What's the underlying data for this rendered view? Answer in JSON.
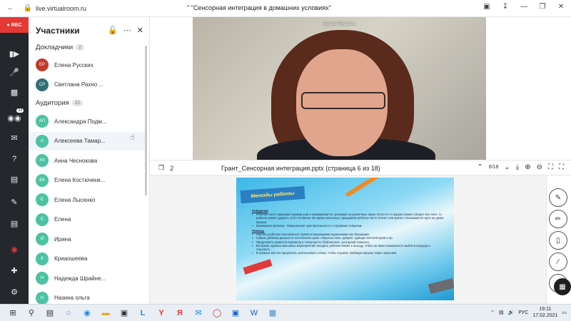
{
  "browser": {
    "url": "live.virtualroom.ru",
    "tab_title": "\" \"Сенсорная интеграция в домашних условиях\""
  },
  "rail": {
    "rec_label": "REC",
    "chat_badge": "24"
  },
  "panel": {
    "title": "Участники",
    "speakers_label": "Докладчики",
    "speakers_count": "2",
    "audience_label": "Аудитория",
    "audience_count": "22",
    "speakers": [
      {
        "initials": "ЕР",
        "name": "Елена Русских",
        "color": "#c0392b"
      },
      {
        "initials": "СР",
        "name": "Светлана Рахно ...",
        "color": "#2f6f73"
      }
    ],
    "audience": [
      {
        "initials": "АП",
        "name": "Александра Подм...",
        "color": "#4cc3a2"
      },
      {
        "initials": "А",
        "name": "Алексеева Тамар...",
        "color": "#4cc3a2"
      },
      {
        "initials": "АЧ",
        "name": "Анна Чеснокова",
        "color": "#4cc3a2"
      },
      {
        "initials": "ЕК",
        "name": "Елена Костюченк...",
        "color": "#4cc3a2"
      },
      {
        "initials": "Е",
        "name": "Елена Лысенко",
        "color": "#4cc3a2"
      },
      {
        "initials": "Е",
        "name": "Елена",
        "color": "#4cc3a2"
      },
      {
        "initials": "И",
        "name": "Ирина",
        "color": "#4cc3a2"
      },
      {
        "initials": "К",
        "name": "Криаошеева",
        "color": "#4cc3a2"
      },
      {
        "initials": "Н",
        "name": "Надежда Шрайне...",
        "color": "#4cc3a2"
      },
      {
        "initials": "Н",
        "name": "Назина ольга",
        "color": "#4cc3a2"
      }
    ]
  },
  "video": {
    "speaker_name": "Елена Русских"
  },
  "presentation": {
    "layout_count": "2",
    "file_title": "Грант_Сенсорная интеграция.pptx (страница 6 из 18)",
    "pager": "6/18"
  },
  "slide": {
    "title": "Методы работы",
    "sections": [
      {
        "heading": "Поведение",
        "items": [
          "Ребенок часто закрывает руками уши и зажмуривается, реагируя на различные звуки. Если кто-то рядом громко говорит или поет, то ребенок может ударить этого человека. Во время школьных праздников ребенок часто плачет или кричит, отказывается идти на уроки музыки.",
          "Возможная причина - Повышенная чувствительность к слуховым стимулам."
        ]
      },
      {
        "heading": "Помощь",
        "items": [
          "Научить ребенка пользоваться шумопоглощающими наушниками или берушами.",
          "Сажать ребенка дальше от источников шума: открытых окон, дверей, гудящих вентиляторов и пр.",
          "Предложить провести перемену в тихом месте (библиотеке, сенсорной комнате).",
          "Во время шумных массовых мероприятий посадить ребенка ближе к выходу, чтобы он имел возможность выйти в коридор и отдохнуть.",
          "В шумных местах предлагать использовать плеер, чтобы слушать любимую музыку через наушники."
        ]
      }
    ]
  },
  "taskbar": {
    "lang": "РУС",
    "time": "19:11",
    "date": "17.02.2021"
  },
  "colors": {
    "rec": "#e53935",
    "rail": "#24272b",
    "avatar_audience": "#4cc3a2"
  }
}
